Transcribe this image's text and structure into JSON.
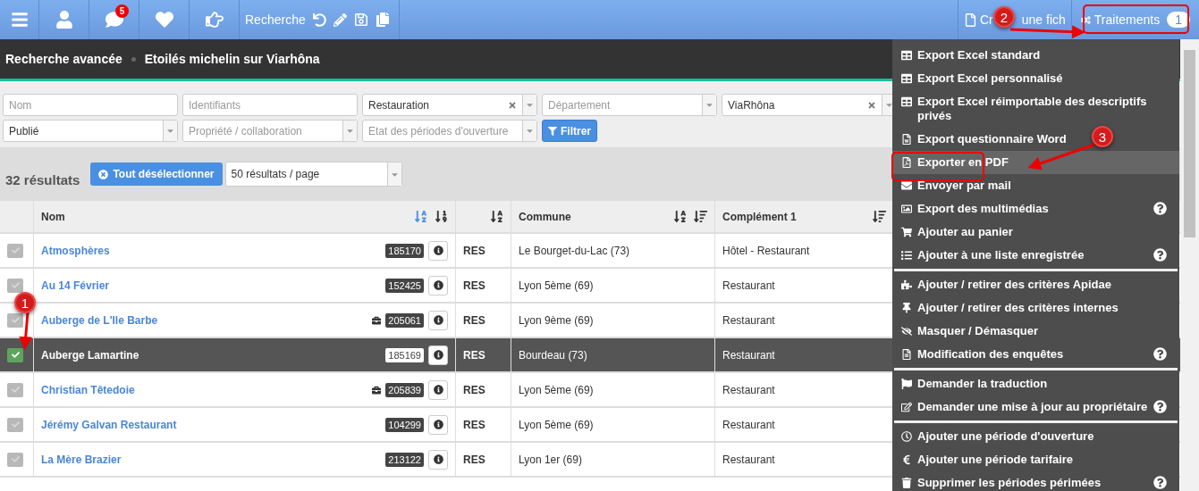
{
  "toolbar": {
    "notifications": "5",
    "search_label": "Recherche",
    "create_label": "Cr",
    "create_label_rest": "une fich",
    "actions_label": "Traitements",
    "actions_count": "1"
  },
  "breadcrumb": [
    "Recherche avancée",
    "Etoilés michelin sur Viarhôna"
  ],
  "filters": [
    {
      "kind": "text",
      "placeholder": "Nom"
    },
    {
      "kind": "text",
      "placeholder": "Identifiants"
    },
    {
      "kind": "select",
      "value": "Restauration",
      "clearable": true
    },
    {
      "kind": "select",
      "placeholder": "Département"
    },
    {
      "kind": "select",
      "value": "ViaRhôna",
      "clearable": true
    },
    {
      "kind": "select",
      "value": "Publié"
    },
    {
      "kind": "select",
      "placeholder": "Propriété / collaboration"
    },
    {
      "kind": "select",
      "placeholder": "Etat des périodes d'ouverture"
    }
  ],
  "filter_button": "Filtrer",
  "results": {
    "count": "32 résultats",
    "deselect_button": "Tout désélectionner",
    "page_size": "50 résultats / page"
  },
  "table": {
    "columns": [
      {
        "label": "Nom",
        "sorts": [
          {
            "kind": "alpha",
            "selected": true
          },
          {
            "kind": "numeric",
            "selected": false
          }
        ]
      },
      {
        "sorts": [
          {
            "kind": "alpha",
            "selected": false
          }
        ]
      },
      {
        "label": "Commune",
        "sorts": [
          {
            "kind": "alpha",
            "selected": false
          },
          {
            "kind": "amount",
            "selected": false
          }
        ]
      },
      {
        "label": "Complément 1",
        "sorts": [
          {
            "kind": "amount",
            "selected": false
          }
        ]
      }
    ],
    "rows": [
      {
        "name": "Atmosphères",
        "id": "185170",
        "briefcase": false,
        "type": "RES",
        "commune": "Le Bourget-du-Lac (73)",
        "complement": "Hôtel - Restaurant",
        "selected": false
      },
      {
        "name": "Au 14 Février",
        "id": "152425",
        "briefcase": false,
        "type": "RES",
        "commune": "Lyon 5ème (69)",
        "complement": "Restaurant",
        "selected": false
      },
      {
        "name": "Auberge de L'Ile Barbe",
        "id": "205061",
        "briefcase": true,
        "type": "RES",
        "commune": "Lyon 9ème (69)",
        "complement": "Restaurant",
        "selected": false
      },
      {
        "name": "Auberge Lamartine",
        "id": "185169",
        "briefcase": false,
        "type": "RES",
        "commune": "Bourdeau (73)",
        "complement": "Restaurant",
        "selected": true
      },
      {
        "name": "Christian Têtedoie",
        "id": "205839",
        "briefcase": true,
        "type": "RES",
        "commune": "Lyon 5ème (69)",
        "complement": "Restaurant",
        "selected": false
      },
      {
        "name": "Jérémy Galvan Restaurant",
        "id": "104299",
        "briefcase": false,
        "type": "RES",
        "commune": "Lyon 5ème (69)",
        "complement": "Restaurant",
        "selected": false
      },
      {
        "name": "La Mère Brazier",
        "id": "213122",
        "briefcase": false,
        "type": "RES",
        "commune": "Lyon 1er (69)",
        "complement": "Restaurant",
        "selected": false
      }
    ]
  },
  "menu": [
    {
      "items": [
        {
          "label": "Export Excel standard",
          "help": false,
          "selected": false
        },
        {
          "label": "Export Excel personnalisé",
          "help": false,
          "selected": false
        },
        {
          "label": "Export Excel réimportable des descriptifs privés",
          "help": false,
          "selected": false
        },
        {
          "label": "Export questionnaire Word",
          "help": false,
          "selected": false
        },
        {
          "label": "Exporter en PDF",
          "help": false,
          "selected": true
        },
        {
          "label": "Envoyer par mail",
          "help": false,
          "selected": false
        },
        {
          "label": "Export des multimédias",
          "help": true,
          "selected": false
        },
        {
          "label": "Ajouter au panier",
          "help": false,
          "selected": false
        },
        {
          "label": "Ajouter à une liste enregistrée",
          "help": true,
          "selected": false
        }
      ]
    },
    {
      "items": [
        {
          "label": "Ajouter / retirer des critères Apidae",
          "help": false,
          "selected": false
        },
        {
          "label": "Ajouter / retirer des critères internes",
          "help": false,
          "selected": false
        },
        {
          "label": "Masquer / Démasquer",
          "help": false,
          "selected": false
        },
        {
          "label": "Modification des enquêtes",
          "help": true,
          "selected": false
        }
      ]
    },
    {
      "items": [
        {
          "label": "Demander la traduction",
          "help": false,
          "selected": false
        },
        {
          "label": "Demander une mise à jour au propriétaire",
          "help": true,
          "selected": false
        }
      ]
    },
    {
      "items": [
        {
          "label": "Ajouter une période d'ouverture",
          "help": false,
          "selected": false
        },
        {
          "label": "Ajouter une période tarifaire",
          "help": false,
          "selected": false
        },
        {
          "label": "Supprimer les périodes périmées",
          "help": true,
          "selected": false
        }
      ]
    }
  ],
  "annotations": [
    {
      "label": "1"
    },
    {
      "label": "2"
    },
    {
      "label": "3"
    }
  ]
}
